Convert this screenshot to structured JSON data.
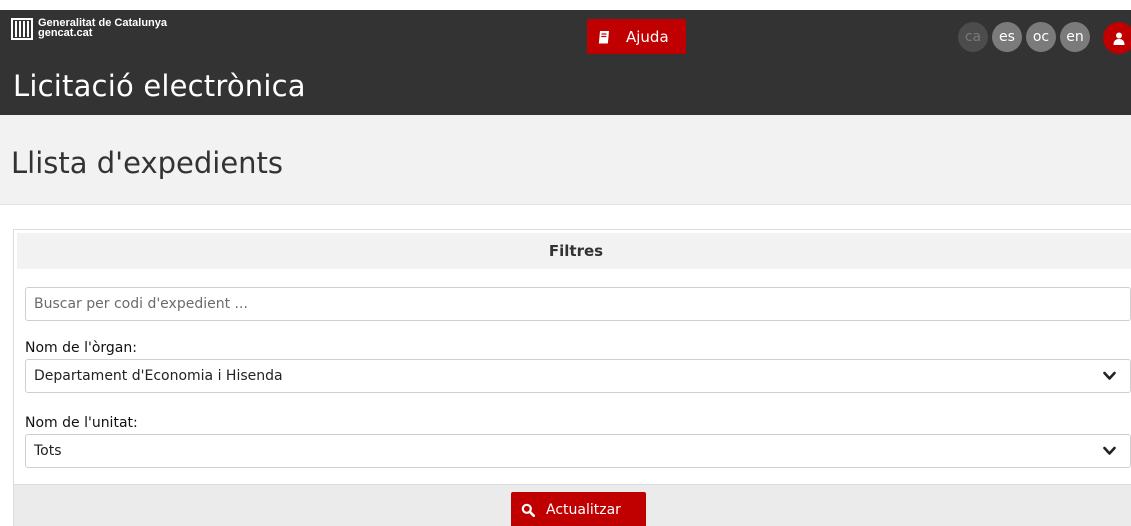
{
  "header": {
    "brand_line1": "Generalitat de Catalunya",
    "brand_line2": "gencat.cat",
    "help_label": "Ajuda",
    "app_title": "Licitació electrònica",
    "languages": [
      "ca",
      "es",
      "oc",
      "en"
    ],
    "active_language": "ca"
  },
  "page": {
    "title": "Llista d'expedients"
  },
  "filters": {
    "heading": "Filtres",
    "search_placeholder": "Buscar per codi d'expedient ...",
    "search_value": "",
    "organ_label": "Nom de l'òrgan:",
    "organ_value": "Departament d'Economia i Hisenda",
    "unit_label": "Nom de l'unitat:",
    "unit_value": "Tots",
    "update_label": "Actualitzar"
  },
  "colors": {
    "header_bg": "#333333",
    "accent_red": "#c00000",
    "band_bg": "#f2f2f2"
  },
  "icons": {
    "logo": "generalitat-logo-icon",
    "help": "book-icon",
    "user": "user-icon",
    "select": "chevron-down-icon",
    "update": "search-icon"
  }
}
